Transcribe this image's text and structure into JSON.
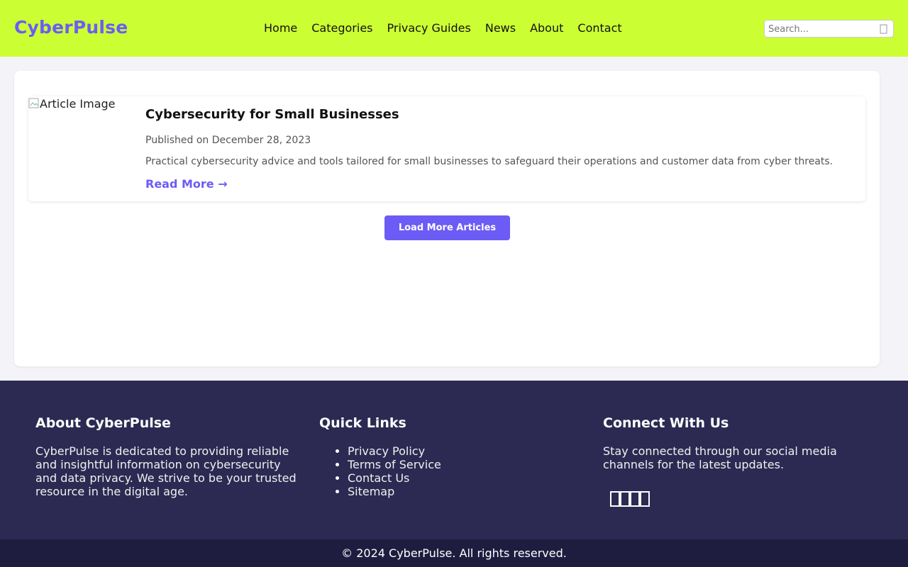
{
  "site": {
    "logo": "CyberPulse"
  },
  "nav": {
    "items": [
      {
        "label": "Home"
      },
      {
        "label": "Categories"
      },
      {
        "label": "Privacy Guides"
      },
      {
        "label": "News"
      },
      {
        "label": "About"
      },
      {
        "label": "Contact"
      }
    ]
  },
  "search": {
    "placeholder": "Search...",
    "icon": "search-icon"
  },
  "articles": [
    {
      "image_alt": "Article Image",
      "title": "Cybersecurity for Small Businesses",
      "date": "Published on December 28, 2023",
      "description": "Practical cybersecurity advice and tools tailored for small businesses to safeguard their operations and customer data from cyber threats.",
      "read_more": "Read More →"
    }
  ],
  "load_more_label": "Load More Articles",
  "footer": {
    "about": {
      "heading": "About CyberPulse",
      "text": "CyberPulse is dedicated to providing reliable and insightful information on cybersecurity and data privacy. We strive to be your trusted resource in the digital age."
    },
    "quick_links": {
      "heading": "Quick Links",
      "items": [
        "Privacy Policy",
        "Terms of Service",
        "Contact Us",
        "Sitemap"
      ]
    },
    "connect": {
      "heading": "Connect With Us",
      "text": "Stay connected through our social media channels for the latest updates.",
      "icons": [
        "facebook-icon",
        "twitter-icon",
        "linkedin-icon",
        "instagram-icon"
      ]
    },
    "copyright": "© 2024 CyberPulse. All rights reserved."
  },
  "colors": {
    "header_bg": "#ccff33",
    "accent": "#6c5cf5",
    "footer_bg": "#2c2a52",
    "footer_bottom_bg": "#1e1d3f"
  }
}
